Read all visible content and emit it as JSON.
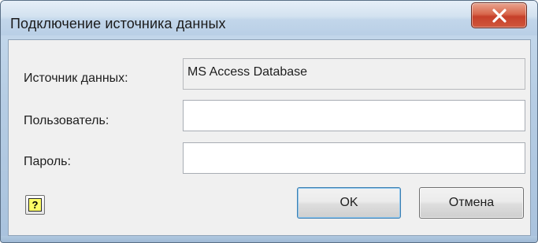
{
  "window": {
    "title": "Подключение источника данных",
    "close_icon": "close-icon"
  },
  "form": {
    "datasource_label": "Источник данных:",
    "datasource_value": "MS Access Database",
    "user_label": "Пользователь:",
    "user_value": "",
    "password_label": "Пароль:",
    "password_value": ""
  },
  "buttons": {
    "help_glyph": "?",
    "ok_label": "OK",
    "cancel_label": "Отмена"
  },
  "colors": {
    "close_button": "#d0573c",
    "help_icon_fill": "#ffff66",
    "default_button_border": "#3c7fb1"
  }
}
